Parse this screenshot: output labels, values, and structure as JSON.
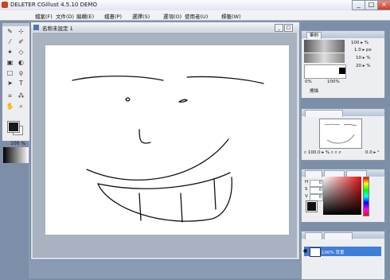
{
  "app": {
    "title": "DELETER CGillust 4.5.10 DEMO"
  },
  "menu": [
    "檔案(F)",
    "文件(D)",
    "編輯(E)",
    "檔畫(P)",
    "選擇(S)",
    "選項(O)",
    "使用者(U)",
    "標籤(W)"
  ],
  "document": {
    "title": "名称未設定 1"
  },
  "toolbox": {
    "zoom_value": "100",
    "zoom_unit": "%"
  },
  "brush_panel": {
    "tab": "筆刷",
    "opacity": "100",
    "size": "1.0",
    "min": "10",
    "spacing": "20",
    "unit_pct": "%",
    "unit_px": "px",
    "mode_label": "擦描",
    "pct_left": "0%",
    "pct_right": "100%"
  },
  "navigator_panel": {
    "zoom": "100.0",
    "rotation": "0.0",
    "unit": "%",
    "deg": "°"
  },
  "color_panel": {
    "labels": [
      "H",
      "S",
      "V"
    ],
    "values": [
      "0",
      "0",
      "0"
    ]
  },
  "layer_panel": {
    "layer_name": "100% 背景"
  },
  "colors": {
    "accent": "#3d7ed8",
    "workspace": "#8a9bb3",
    "close_btn": "#c8412f"
  }
}
